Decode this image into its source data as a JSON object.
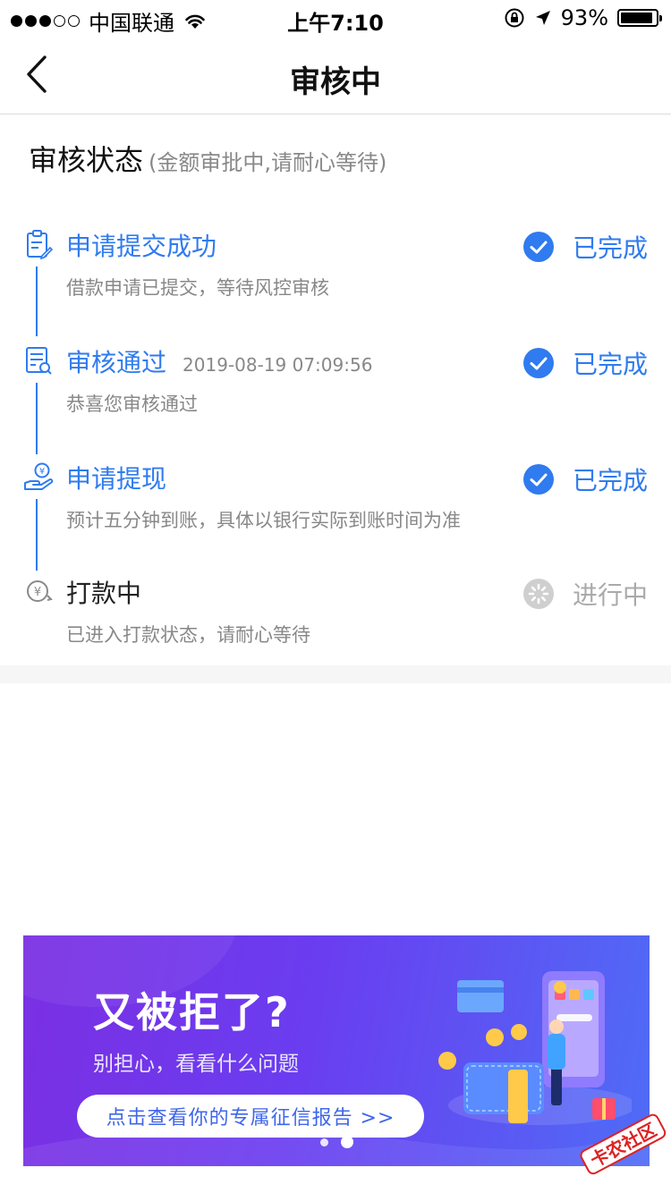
{
  "status_bar": {
    "carrier": "中国联通",
    "time": "上午7:10",
    "battery": "93%",
    "battery_level": 0.93
  },
  "nav": {
    "title": "审核中"
  },
  "section": {
    "title": "审核状态",
    "subtitle": "(金额审批中,请耐心等待)"
  },
  "steps": [
    {
      "name": "申请提交成功",
      "time": "",
      "desc": "借款申请已提交，等待风控审核",
      "state": "已完成",
      "icon": "clipboard-edit-icon"
    },
    {
      "name": "审核通过",
      "time": "2019-08-19 07:09:56",
      "desc": "恭喜您审核通过",
      "state": "已完成",
      "icon": "document-search-icon"
    },
    {
      "name": "申请提现",
      "time": "",
      "desc": "预计五分钟到账，具体以银行实际到账时间为准",
      "state": "已完成",
      "icon": "hand-yuan-icon"
    },
    {
      "name": "打款中",
      "time": "",
      "desc": "已进入打款状态，请耐心等待",
      "state": "进行中",
      "icon": "yuan-cycle-icon"
    }
  ],
  "banner": {
    "headline": "又被拒了?",
    "subline": "别担心，看看什么问题",
    "cta": "点击查看你的专属征信报告 >>",
    "pages": 2,
    "active_page": 2
  },
  "watermark": {
    "text": "卡农社区"
  },
  "colors": {
    "accent": "#2f7bef",
    "muted": "#888888",
    "pending": "#aaaaaa",
    "banner_start": "#7b2fe3",
    "banner_end": "#4f6cf6"
  }
}
